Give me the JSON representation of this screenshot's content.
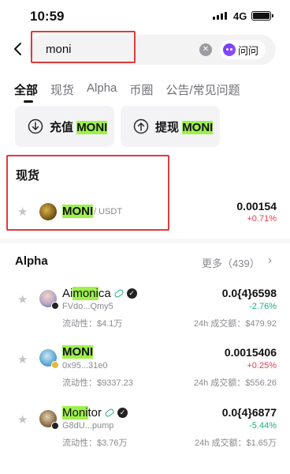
{
  "status_bar": {
    "time": "10:59",
    "network": "4G"
  },
  "search": {
    "query": "moni",
    "ask_label": "问问"
  },
  "tabs": [
    "全部",
    "现货",
    "Alpha",
    "币圈",
    "公告/常见问题"
  ],
  "actions": {
    "deposit": {
      "prefix": "充值",
      "highlight": "MONI"
    },
    "withdraw": {
      "prefix": "提现",
      "highlight": "MONI"
    }
  },
  "spot": {
    "title": "现货",
    "items": [
      {
        "symbol": "MONI",
        "pair": "/ USDT",
        "price": "0.00154",
        "change": "+0.71%"
      }
    ]
  },
  "alpha": {
    "title": "Alpha",
    "more": "更多（439）",
    "items": [
      {
        "name_pre": "Ai",
        "name_hl": "moni",
        "name_post": "ca",
        "address": "FVdo...Qmy5",
        "liquidity": "流动性：$4.1万",
        "price": "0.0{4}6598",
        "change": "-2.76%",
        "volume": "24h 成交额：$479.92"
      },
      {
        "name_pre": "",
        "name_hl": "MONI",
        "name_post": "",
        "address": "0x95...31e0",
        "liquidity": "流动性：$9337.23",
        "price": "0.0015406",
        "change": "+0.25%",
        "volume": "24h 成交额：$556.26"
      },
      {
        "name_pre": "",
        "name_hl": "Moni",
        "name_post": "tor",
        "address": "G8dU...pump",
        "liquidity": "流动性：$3.76万",
        "price": "0.0{4}6877",
        "change": "-5.44%",
        "volume": "24h 成交额：$1.65万"
      }
    ]
  },
  "colors": {
    "highlight": "#9ef04a",
    "up": "#16b27a",
    "down": "#ee3a50",
    "annotation_box": "#e03a3a"
  }
}
